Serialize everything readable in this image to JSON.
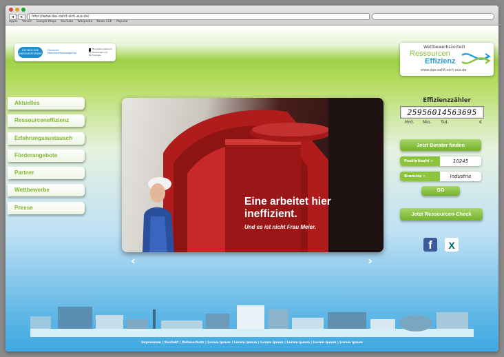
{
  "browser": {
    "url": "http://www.das-zahlt-sich-aus.de/",
    "bookmarks": [
      "Apple",
      "Yahoo!",
      "Google Maps",
      "YouTube",
      "Wikipedia",
      "News (33)",
      "Popular"
    ],
    "nav_back": "◂",
    "nav_forward": "▸",
    "nav_add": "+"
  },
  "header": {
    "partner_logos": {
      "circle_text": "DIE WEG ZUR ENERGIEEFFIZIENZ",
      "demea_text": "Deutsche Materialeffizienzagentur",
      "bmwi_text": "Bundesministerium für Wirtschaft und Technologie"
    },
    "brand": {
      "tagline": "Wettbewerbsvorteil!",
      "word1": "Ressourcen",
      "word2": "Effizienz",
      "url": "www.das-zahlt-sich-aus.de"
    }
  },
  "nav": {
    "items": [
      "Aktuelles",
      "Ressourceneffizienz",
      "Erfahrungsaustausch",
      "Förderangebote",
      "Partner",
      "Wettbewerbe",
      "Presse"
    ]
  },
  "hero": {
    "headline": "Eine arbeitet hier ineffizient.",
    "subline": "Und es ist nicht Frau Meier.",
    "prev": "‹",
    "next": "›"
  },
  "counter": {
    "title": "Effizienzzähler",
    "value": "25956014563695",
    "units": [
      "Mrd.",
      "Mio.",
      "Tsd.",
      "€"
    ]
  },
  "berater": {
    "button_label": "Jetzt Berater finden",
    "plz_label": "Postleitzahl »",
    "plz_value": "10245",
    "branche_label": "Branche »",
    "branche_value": "Industrie",
    "go_label": "GO"
  },
  "check": {
    "button_label": "Jetzt Ressourcen-Check"
  },
  "social": {
    "facebook": "f",
    "xing": "X"
  },
  "colors": {
    "accent_green": "#8cc43c",
    "accent_blue": "#2aa0d8"
  },
  "footer": {
    "links": "Impressum | Kontakt | Datenschutz | Lorem ipsum | Lorem ipsum | Lorem ipsum | Lorem ipsum | Lorem ipsum | Lorem ipsum"
  }
}
